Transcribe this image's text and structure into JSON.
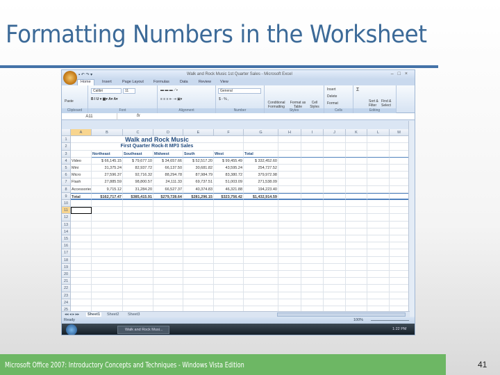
{
  "slide": {
    "title": "Formatting Numbers in the Worksheet",
    "footer": "Microsoft Office 2007: Introductory Concepts and Techniques - Windows Vista Edition",
    "page_number": "41"
  },
  "excel": {
    "window_title": "Walk and Rock Music 1st Quarter Sales - Microsoft Excel",
    "tabs": [
      "Home",
      "Insert",
      "Page Layout",
      "Formulas",
      "Data",
      "Review",
      "View"
    ],
    "ribbon": {
      "paste": "Paste",
      "font": "Calibri",
      "size": "11",
      "number_format": "General",
      "conditional": "Conditional Formatting",
      "format_table": "Format as Table",
      "cell_styles": "Cell Styles",
      "insert": "Insert",
      "delete": "Delete",
      "format": "Format",
      "sort": "Sort & Filter",
      "find": "Find & Select",
      "groups": [
        "Clipboard",
        "Font",
        "Alignment",
        "Number",
        "Styles",
        "Cells",
        "Editing"
      ],
      "currency": "$ - %  ,"
    },
    "name_box": "A11",
    "fx": "fx",
    "columns": [
      "A",
      "B",
      "C",
      "D",
      "E",
      "F",
      "G",
      "H",
      "I",
      "J",
      "K",
      "L",
      "M"
    ],
    "rows": [
      [
        "",
        "Walk and Rock Music"
      ],
      [
        "",
        "First Quarter Rock-It MP3 Sales"
      ],
      [
        "",
        "Northeast",
        "Southeast",
        "Midwest",
        "South",
        "West",
        "Total"
      ],
      [
        "Video",
        "$  66,145.15",
        "$  79,677.10",
        "$  34,657.66",
        "$  52,517.20",
        "$  99,455.49",
        "$    332,452.60"
      ],
      [
        "Mini",
        "31,375.24",
        "82,937.72",
        "66,137.50",
        "30,681.82",
        "43,595.24",
        "254,727.52"
      ],
      [
        "Micro",
        "27,596.37",
        "92,716.32",
        "88,294.78",
        "87,984.79",
        "83,380.72",
        "379,972.98"
      ],
      [
        "Flash",
        "27,885.59",
        "98,800.57",
        "24,111.33",
        "69,737.51",
        "51,003.09",
        "271,538.09"
      ],
      [
        "Accessories",
        "9,715.12",
        "31,284.20",
        "66,527.37",
        "40,374.83",
        "46,321.88",
        "194,223.40"
      ],
      [
        "Total",
        "$162,717.47",
        "$385,415.91",
        "$279,728.64",
        "$281,296.15",
        "$323,756.42",
        "$1,432,914.59"
      ]
    ],
    "row_count": 25,
    "sheets": [
      "Sheet1",
      "Sheet2",
      "Sheet3"
    ],
    "status": "Ready",
    "zoom": "100%",
    "taskbar_item": "Walk and Rock Musi...",
    "clock": "1:22 PM"
  }
}
